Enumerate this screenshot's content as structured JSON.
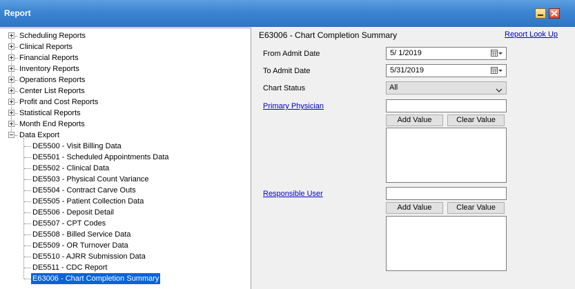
{
  "window": {
    "title": "Report"
  },
  "tree": {
    "categories": [
      {
        "label": "Scheduling Reports",
        "expanded": false
      },
      {
        "label": "Clinical Reports",
        "expanded": false
      },
      {
        "label": "Financial Reports",
        "expanded": false
      },
      {
        "label": "Inventory Reports",
        "expanded": false
      },
      {
        "label": "Operations Reports",
        "expanded": false
      },
      {
        "label": "Center List Reports",
        "expanded": false
      },
      {
        "label": "Profit and Cost Reports",
        "expanded": false
      },
      {
        "label": "Statistical Reports",
        "expanded": false
      },
      {
        "label": "Month End Reports",
        "expanded": false
      },
      {
        "label": "Data Export",
        "expanded": true
      }
    ],
    "data_export_items": [
      "DE5500 - Visit Billing Data",
      "DE5501 - Scheduled Appointments Data",
      "DE5502 - Clinical Data",
      "DE5503 - Physical Count Variance",
      "DE5504 - Contract Carve Outs",
      "DE5505 - Patient Collection Data",
      "DE5506 - Deposit Detail",
      "DE5507 - CPT Codes",
      "DE5508 - Billed Service Data",
      "DE5509 - OR Turnover Data",
      "DE5510 - AJRR Submission Data",
      "DE5511 - CDC Report",
      "E63006 - Chart Completion Summary"
    ],
    "selected_item": "E63006 - Chart Completion Summary"
  },
  "report": {
    "heading": "E63006 - Chart Completion Summary",
    "lookup_link": "Report Look Up",
    "from_label": "From Admit Date",
    "from_value": "5/  1/2019",
    "to_label": "To Admit Date",
    "to_value": "5/31/2019",
    "status_label": "Chart Status",
    "status_value": "All",
    "physician_label": "Primary Physician",
    "physician_value": "",
    "responsible_label": "Responsible User",
    "responsible_value": "",
    "add_value_label": "Add Value",
    "clear_value_label": "Clear Value"
  },
  "icons": {
    "minimize": "minimize-icon",
    "close": "close-icon",
    "calendar": "calendar-icon",
    "expand": "expand-icon",
    "collapse": "collapse-icon",
    "dropdown": "chevron-down-icon"
  },
  "colors": {
    "titlebar": "#3c85d1",
    "selection": "#0a64d8",
    "link": "#0000cc"
  }
}
